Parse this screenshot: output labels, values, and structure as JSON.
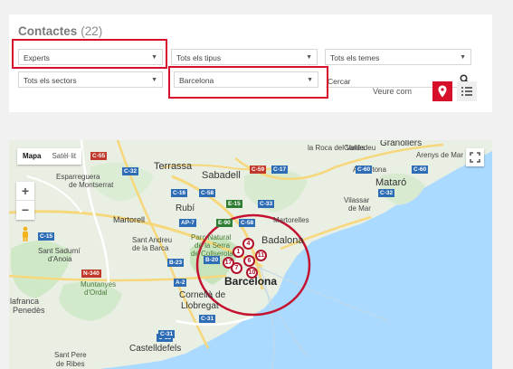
{
  "filters": {
    "title": "Contactes",
    "count": "(22)",
    "experts": "Experts",
    "tipus": "Tots els tipus",
    "temes": "Tots els temes",
    "sectors": "Tots els sectors",
    "city": "Barcelona",
    "search_placeholder": "Cercar"
  },
  "view": {
    "label": "Veure com",
    "map_icon": "map-pin-icon",
    "list_icon": "list-icon"
  },
  "map": {
    "type_map": "Mapa",
    "type_satellite": "Satèl·lit",
    "labels": {
      "terrassa": "Terrassa",
      "sabadell": "Sabadell",
      "badalona": "Badalona",
      "barcelona": "Barcelona",
      "mataro": "Mataró",
      "rubi": "Rubí",
      "martorell": "Martorell",
      "castelldefels": "Castelldefels",
      "cornella": "Cornellà de",
      "llobregat": "Llobregat",
      "sant_andreu": "Sant Andreu",
      "de_la_barca": "de la Barca",
      "sant_sadurni": "Sant Sadurní",
      "danoia": "d'Anoia",
      "granollers": "Granollers",
      "de_montserrat": "de Montserrat",
      "esparreguera": "Esparreguera",
      "la_roca": "la Roca del Vallès",
      "arenys": "Arenys de Mar",
      "vilassar1": "Vilassar",
      "vilassar2": "de Mar",
      "parc1": "Parc Natural",
      "parc2": "de la Serra",
      "parc3": "de Collserola",
      "muntanyes1": "Muntanyes",
      "muntanyes2": "d'Ordal",
      "llafranca": "lafranca",
      "penedes": "Penedès",
      "sant_pere1": "Sant Pere",
      "sant_pere2": "de Ribes",
      "argentona": "Argentona",
      "cardedeu": "Cardedeu",
      "martorelles": "Martorelles"
    },
    "roads": [
      "C-55",
      "C-58",
      "C-17",
      "C-59",
      "E-15",
      "C-16",
      "AP-7",
      "C-33",
      "C-58",
      "C-32",
      "C-60",
      "C-60",
      "B-23",
      "A-2",
      "N-340",
      "C-31",
      "C-32",
      "C-15",
      "C-32",
      "C-31",
      "B-20",
      "E-90"
    ],
    "markers": [
      "4",
      "1",
      "6",
      "11",
      "7",
      "17",
      "10"
    ],
    "zoom_in": "+",
    "zoom_out": "−"
  }
}
